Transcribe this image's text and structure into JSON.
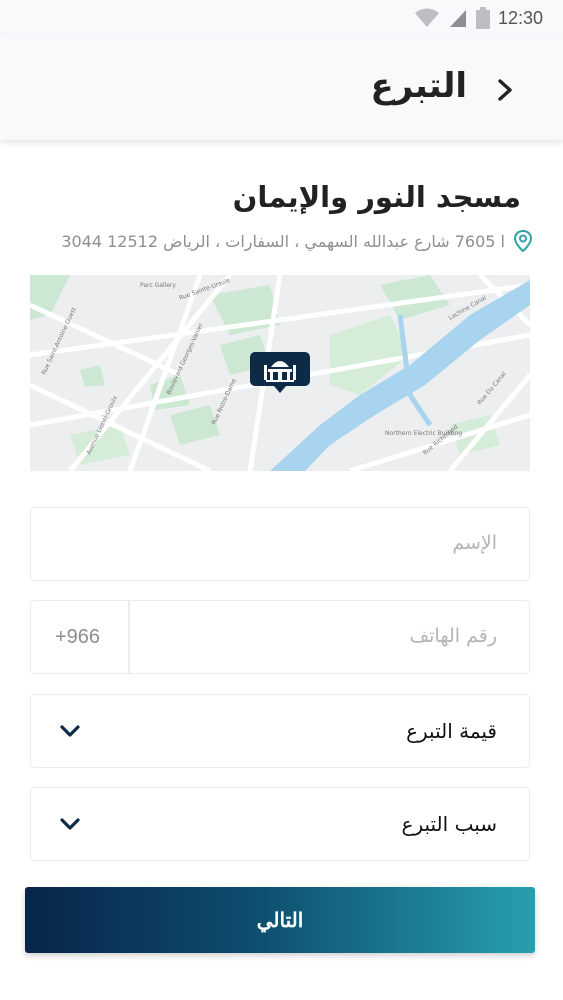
{
  "status_bar": {
    "time": "12:30"
  },
  "header": {
    "title": "التبرع"
  },
  "mosque": {
    "name": "مسجد النور والإيمان",
    "address": "ا 7605 شارع عبدالله السهمي ، السفارات ، الرياض 12512 3044"
  },
  "map": {
    "labels": [
      "Rue Sainte-Ursule",
      "Rue Notre-Dame",
      "Boulevard Georges-Vanier",
      "Avenue Lionel-Groulx",
      "Rue Richmond",
      "Rue Du Canal",
      "Northern Electric Building",
      "Parc Gallery",
      "Lachine Canal",
      "Rue Saint-Antoine Ouest"
    ]
  },
  "form": {
    "name_placeholder": "الإسم",
    "phone_placeholder": "رقم الهاتف",
    "phone_code": "+966",
    "donation_value_label": "قيمة التبرع",
    "donation_reason_label": "سبب التبرع"
  },
  "actions": {
    "next_label": "التالي"
  },
  "colors": {
    "button_start": "#07254a",
    "button_end": "#27a0ad",
    "location_icon": "#2fa3a5",
    "water": "#a8d4ef",
    "park": "#cde8d2"
  }
}
